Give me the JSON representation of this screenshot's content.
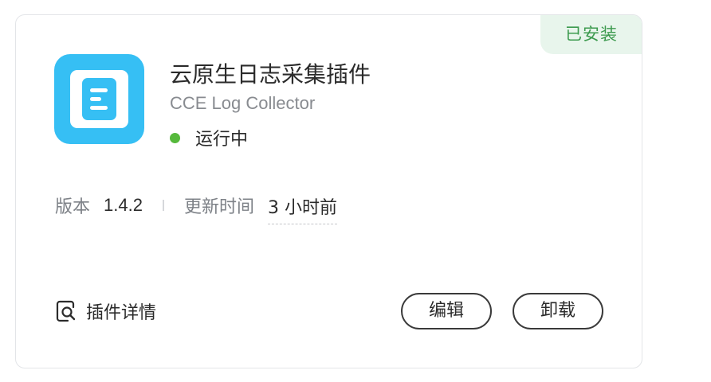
{
  "card": {
    "badge": "已安装",
    "icon": "document-list-icon",
    "title": "云原生日志采集插件",
    "subtitle": "CCE Log Collector",
    "status": {
      "text": "运行中",
      "color": "#56b93c"
    },
    "meta": {
      "version_label": "版本",
      "version_value": "1.4.2",
      "updated_label": "更新时间",
      "updated_value": "3 小时前"
    },
    "details_label": "插件详情",
    "details_icon": "search-document-icon",
    "actions": {
      "edit_label": "编辑",
      "uninstall_label": "卸载"
    }
  },
  "colors": {
    "icon_bg": "#36bff4",
    "badge_bg": "#e8f5ec",
    "badge_text": "#3c9a4e"
  }
}
